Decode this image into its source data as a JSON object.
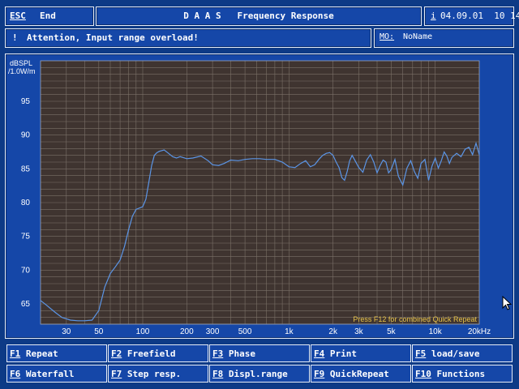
{
  "topbar": {
    "esc_key": "ESC",
    "esc_label": "End",
    "title": "D A A S   Frequency Response",
    "date_prefix": "i",
    "datetime": "04.09.01  10 14"
  },
  "message": {
    "icon": "exclamation-icon",
    "text": "Attention, Input range overload!"
  },
  "mo": {
    "label": "MO:",
    "value": "NoName"
  },
  "plot": {
    "ylabel_line1": "dBSPL",
    "ylabel_line2": "/1.0W/m",
    "hint": "Press F12 for combined Quick Repeat",
    "colors": {
      "background": "#3f3430",
      "grid": "#7b7068",
      "curve": "#5b95e6",
      "hint": "#e8c44a"
    }
  },
  "chart_data": {
    "type": "line",
    "title": "",
    "xlabel": "",
    "ylabel": "dBSPL /1.0W/m",
    "xscale": "log",
    "xlim": [
      20,
      20000
    ],
    "ylim": [
      62,
      101
    ],
    "grid": true,
    "x_ticks": [
      "30",
      "50",
      "100",
      "200",
      "300",
      "500",
      "1k",
      "2k",
      "3k",
      "5k",
      "10k",
      "20kHz"
    ],
    "x_tick_values": [
      30,
      50,
      100,
      200,
      300,
      500,
      1000,
      2000,
      3000,
      5000,
      10000,
      20000
    ],
    "y_ticks": [
      65,
      70,
      75,
      80,
      85,
      90,
      95
    ],
    "series": [
      {
        "x": [
          20,
          22,
          25,
          28,
          32,
          36,
          40,
          45,
          50,
          55,
          60,
          65,
          70,
          75,
          80,
          85,
          90,
          95,
          100,
          105,
          110,
          115,
          120,
          125,
          130,
          140,
          150,
          160,
          170,
          180,
          200,
          220,
          250,
          280,
          300,
          330,
          360,
          400,
          450,
          500,
          560,
          630,
          700,
          800,
          900,
          1000,
          1100,
          1200,
          1300,
          1400,
          1500,
          1600,
          1700,
          1800,
          1900,
          2000,
          2100,
          2200,
          2300,
          2400,
          2500,
          2600,
          2700,
          2800,
          3000,
          3200,
          3400,
          3600,
          3800,
          4000,
          4200,
          4400,
          4600,
          4800,
          5000,
          5300,
          5600,
          6000,
          6400,
          6800,
          7200,
          7600,
          8000,
          8500,
          9000,
          9500,
          10000,
          10500,
          11000,
          11500,
          12000,
          12500,
          13000,
          14000,
          15000,
          16000,
          17000,
          18000,
          19000,
          20000
        ],
        "y": [
          65.5,
          64.8,
          63.8,
          63.0,
          62.6,
          62.5,
          62.5,
          62.6,
          64.0,
          67.5,
          69.5,
          70.5,
          71.5,
          73.5,
          76.0,
          78.0,
          79.0,
          79.2,
          79.4,
          80.5,
          83.0,
          85.5,
          87.0,
          87.4,
          87.6,
          87.8,
          87.3,
          86.8,
          86.6,
          86.8,
          86.5,
          86.6,
          86.9,
          86.2,
          85.6,
          85.5,
          85.8,
          86.3,
          86.2,
          86.4,
          86.5,
          86.5,
          86.4,
          86.4,
          86.0,
          85.3,
          85.2,
          85.8,
          86.2,
          85.3,
          85.6,
          86.4,
          87.0,
          87.3,
          87.4,
          87.0,
          86.0,
          85.2,
          83.7,
          83.3,
          84.6,
          86.2,
          87.0,
          86.4,
          85.2,
          84.5,
          86.3,
          87.1,
          86.0,
          84.4,
          85.5,
          86.3,
          86.0,
          84.4,
          84.9,
          86.4,
          83.9,
          82.6,
          85.1,
          86.2,
          84.6,
          83.6,
          85.8,
          86.4,
          83.3,
          85.4,
          86.6,
          85.1,
          86.2,
          87.5,
          86.9,
          85.8,
          86.7,
          87.3,
          86.8,
          87.9,
          88.2,
          87.1,
          88.8,
          87.1
        ]
      }
    ]
  },
  "fkeys": [
    {
      "key": "F1",
      "label": "Repeat"
    },
    {
      "key": "F2",
      "label": "Freefield"
    },
    {
      "key": "F3",
      "label": "Phase"
    },
    {
      "key": "F4",
      "label": "Print"
    },
    {
      "key": "F5",
      "label": "load/save"
    },
    {
      "key": "F6",
      "label": "Waterfall"
    },
    {
      "key": "F7",
      "label": "Step resp."
    },
    {
      "key": "F8",
      "label": "Displ.range"
    },
    {
      "key": "F9",
      "label": "QuickRepeat"
    },
    {
      "key": "F10",
      "label": "Functions"
    }
  ]
}
